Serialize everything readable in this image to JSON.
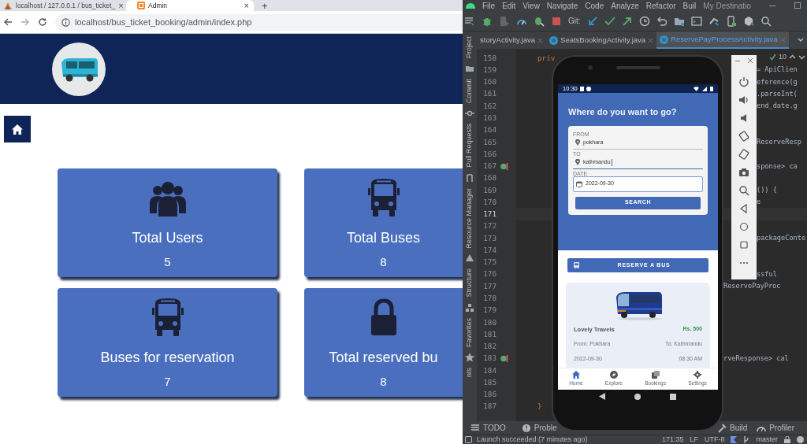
{
  "browser": {
    "tabs": [
      {
        "title": "localhost / 127.0.0.1 / bus_ticket_",
        "close": "×",
        "kind": "sail",
        "selected": false
      },
      {
        "title": "Admin",
        "close": "×",
        "kind": "square",
        "selected": true
      }
    ],
    "new_tab": "+",
    "url": "localhost/bus_ticket_booking/admin/index.php"
  },
  "admin": {
    "stats": [
      {
        "label": "Total Users",
        "value": "5",
        "kind": "users"
      },
      {
        "label": "Total Buses",
        "value": "8",
        "kind": "bus"
      },
      {
        "label": "Buses for reservation",
        "value": "7",
        "kind": "bus"
      },
      {
        "label": "Total reserved bu",
        "value": "8",
        "kind": "lock"
      }
    ]
  },
  "ide": {
    "menu": [
      "File",
      "Edit",
      "View",
      "Navigate",
      "Code",
      "Analyze",
      "Refactor",
      "Buil"
    ],
    "project_title": "My Destinatio",
    "git_label": "Git:",
    "tabs": [
      {
        "title": "storyActivity.java",
        "icon": false,
        "selected": false
      },
      {
        "title": "SeatsBookingActivity.java",
        "icon": true,
        "selected": false
      },
      {
        "title": "ReservePayProcessActivity.java",
        "icon": true,
        "selected": true
      }
    ],
    "tool_windows": [
      "Project",
      "Commit",
      "Pull Requests",
      "Resource Manager",
      "Structure",
      "Favorites",
      "nts"
    ],
    "inspection_count": "10",
    "code_lines": [
      {
        "number": "158",
        "left": "priv",
        "breakpoint": false,
        "current": false
      },
      {
        "number": "159",
        "right": "= ApiClien",
        "breakpoint": false,
        "current": false
      },
      {
        "number": "160",
        "right": "eference(g",
        "breakpoint": false,
        "current": false
      },
      {
        "number": "161",
        "right": ".parseInt(",
        "breakpoint": false,
        "current": false
      },
      {
        "number": "162",
        "right": "end_date.g",
        "breakpoint": false,
        "current": false
      },
      {
        "number": "163",
        "breakpoint": false,
        "current": false
      },
      {
        "number": "164",
        "breakpoint": false,
        "current": false
      },
      {
        "number": "165",
        "right": "ReserveResp",
        "breakpoint": false,
        "current": false
      },
      {
        "number": "166",
        "breakpoint": false,
        "current": false
      },
      {
        "number": "167",
        "right": "sponse> ca",
        "breakpoint": true,
        "current": false
      },
      {
        "number": "168",
        "breakpoint": false,
        "current": false
      },
      {
        "number": "169",
        "right": "()) {",
        "breakpoint": false,
        "current": false
      },
      {
        "number": "170",
        "right": "e",
        "breakpoint": false,
        "current": false
      },
      {
        "number": "171",
        "breakpoint": false,
        "current": true
      },
      {
        "number": "172",
        "breakpoint": false,
        "current": false
      },
      {
        "number": "173",
        "right": "packageConte",
        "breakpoint": false,
        "current": false
      },
      {
        "number": "174",
        "breakpoint": false,
        "current": false
      },
      {
        "number": "175",
        "breakpoint": false,
        "current": false
      },
      {
        "number": "176",
        "right": "ssful",
        "breakpoint": false,
        "current": false
      },
      {
        "number": "177",
        "right": "ReservePayProc",
        "breakpoint": false,
        "current": false
      },
      {
        "number": "178",
        "breakpoint": false,
        "current": false
      },
      {
        "number": "179",
        "breakpoint": false,
        "current": false
      },
      {
        "number": "180",
        "breakpoint": false,
        "current": false
      },
      {
        "number": "181",
        "breakpoint": false,
        "current": false
      },
      {
        "number": "182",
        "breakpoint": false,
        "current": false
      },
      {
        "number": "183",
        "right": "rveResponse> cal",
        "breakpoint": true,
        "current": false
      },
      {
        "number": "184",
        "breakpoint": false,
        "current": false
      },
      {
        "number": "185",
        "breakpoint": false,
        "current": false
      },
      {
        "number": "186",
        "breakpoint": false,
        "current": false
      },
      {
        "number": "187",
        "left": "}",
        "breakpoint": false,
        "current": false
      }
    ],
    "bottom_tools": [
      {
        "label": "TODO",
        "kind": "list"
      },
      {
        "label": "Proble",
        "kind": "alert"
      },
      {
        "label": "Build",
        "kind": "hammer"
      },
      {
        "label": "Profiler",
        "kind": "gauge"
      }
    ],
    "status": {
      "message": "Launch succeeded (7 minutes ago)",
      "position": "171:35",
      "line_separator": "LF",
      "encoding": "UTF-8",
      "branch": "master"
    }
  },
  "phone": {
    "clock": "10:30",
    "heading": "Where do you want to go?",
    "fields": [
      {
        "label": "FROM",
        "value": "pokhara",
        "kind": "place",
        "focused": false
      },
      {
        "label": "TO",
        "value": "kathmandu",
        "kind": "place",
        "focused": true
      },
      {
        "label": "DATE",
        "value": "2022-09-30",
        "kind": "date",
        "focused": false
      }
    ],
    "search_button": "SEARCH",
    "reserve_button": "RESERVE A BUS",
    "bus": {
      "name": "Lovely Travels",
      "price": "Rs. 500",
      "from": "From: Pokhara",
      "to": "To: Kathmandu",
      "date": "2022-09-30",
      "time": "08:30 AM"
    },
    "nav": [
      {
        "label": "Home",
        "kind": "home",
        "selected": true
      },
      {
        "label": "Explore",
        "kind": "explore",
        "selected": false
      },
      {
        "label": "Bookings",
        "kind": "bookings",
        "selected": false
      },
      {
        "label": "Settings",
        "kind": "settings",
        "selected": false
      }
    ]
  }
}
